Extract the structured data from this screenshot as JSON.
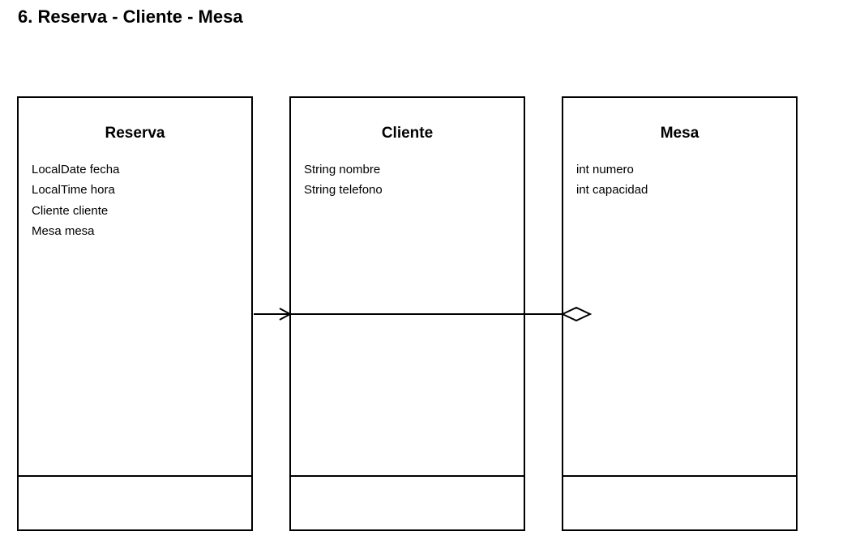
{
  "title": "6. Reserva - Cliente - Mesa",
  "classes": [
    {
      "name": "Reserva",
      "attributes": [
        "LocalDate fecha",
        "LocalTime hora",
        "Cliente cliente",
        "Mesa mesa"
      ],
      "methods": []
    },
    {
      "name": "Cliente",
      "attributes": [
        "String nombre",
        "String telefono"
      ],
      "methods": []
    },
    {
      "name": "Mesa",
      "attributes": [
        "int numero",
        "int capacidad"
      ],
      "methods": []
    }
  ],
  "relationships": [
    {
      "from": "Reserva",
      "to": "Cliente",
      "type": "association",
      "end": "open-arrow"
    },
    {
      "from": "Reserva",
      "to": "Mesa",
      "type": "aggregation",
      "end": "hollow-diamond"
    }
  ],
  "colors": {
    "line": "#000000",
    "background": "#ffffff"
  }
}
